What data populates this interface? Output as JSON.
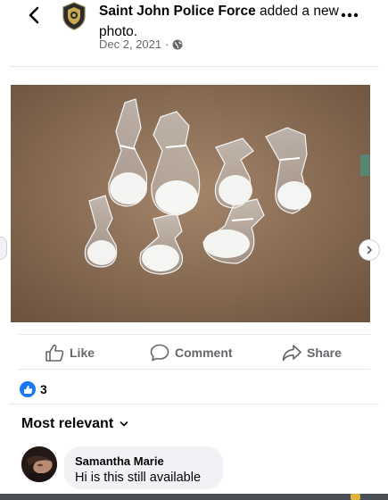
{
  "post": {
    "page_name": "Saint John Police Force",
    "action_text": " added a new photo.",
    "date": "Dec 2, 2021",
    "dot": "·",
    "privacy_icon": "globe-icon"
  },
  "actions": {
    "like_label": "Like",
    "comment_label": "Comment",
    "share_label": "Share"
  },
  "reactions": {
    "count": "3",
    "icon": "like-icon"
  },
  "comments": {
    "sort_label": "Most relevant",
    "items": [
      {
        "author": "Samantha Marie",
        "text": "Hi is this still available"
      }
    ]
  },
  "colors": {
    "accent": "#1877f2",
    "muted": "#65676b",
    "bubble": "#f0f2f5",
    "photo_background": "#8d6e55"
  }
}
